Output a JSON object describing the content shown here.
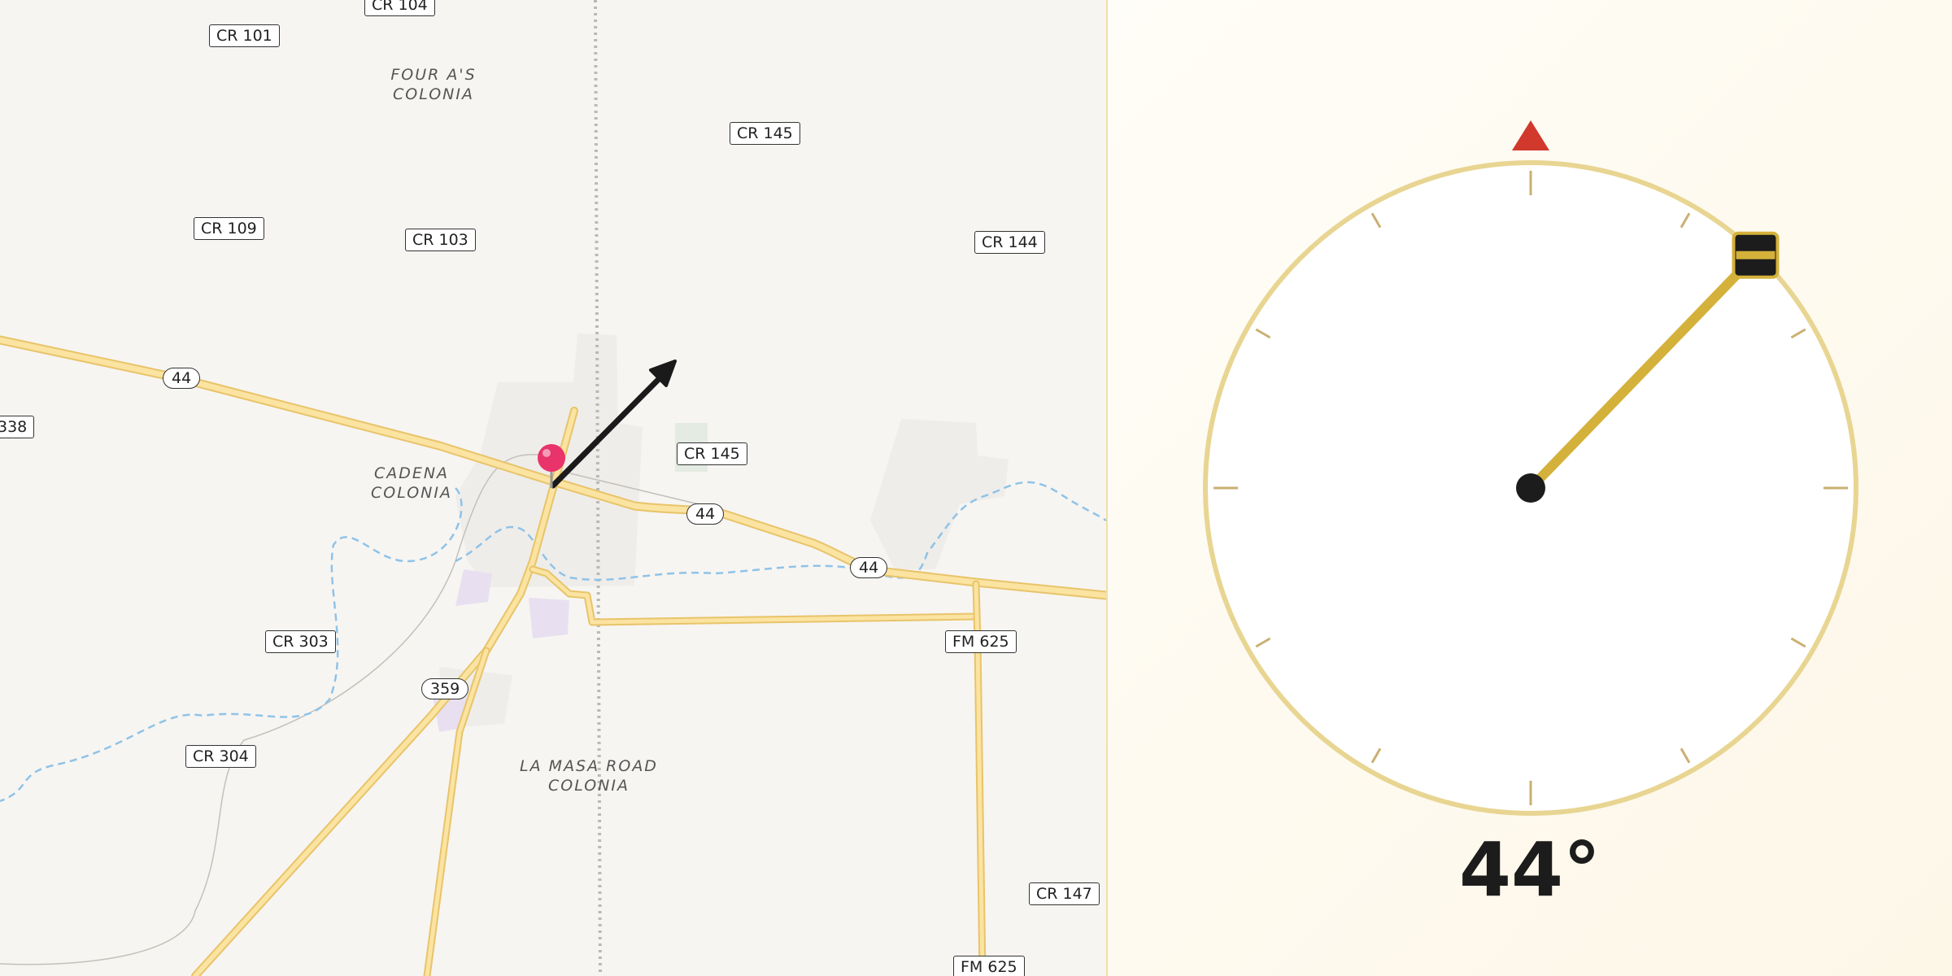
{
  "map": {
    "road_labels": {
      "cr104": "CR 104",
      "cr101": "CR 101",
      "cr109": "CR 109",
      "cr103": "CR 103",
      "cr145_top": "CR 145",
      "cr144": "CR 144",
      "cr145_mid": "CR 145",
      "cr338": "338",
      "cr303": "CR 303",
      "cr304": "CR 304",
      "fm625_mid": "FM 625",
      "fm625_bottom": "FM 625",
      "cr147": "CR 147"
    },
    "highway_shields": {
      "hwy44_left": "44",
      "hwy44_center": "44",
      "hwy44_right": "44",
      "hwy359": "359"
    },
    "places": {
      "four_as_line1": "FOUR A'S",
      "four_as_line2": "COLONIA",
      "cadena_line1": "CADENA",
      "cadena_line2": "COLONIA",
      "la_masa_line1": "LA MASA ROAD",
      "la_masa_line2": "COLONIA"
    },
    "colors": {
      "background": "#f7f5f2",
      "road_fill": "#fbe3a1",
      "road_casing": "#e8c46a",
      "river": "#8fc3e8",
      "pin": "#e8336b",
      "heading_arrow": "#1a1a1a"
    },
    "pin_icon": "map-pin-icon"
  },
  "compass": {
    "heading_text": "44°",
    "heading_degrees": 44,
    "colors": {
      "ring": "#e8d592",
      "needle": "#d4b13a",
      "north_marker": "#d0392b",
      "hub": "#1c1c1c"
    }
  }
}
